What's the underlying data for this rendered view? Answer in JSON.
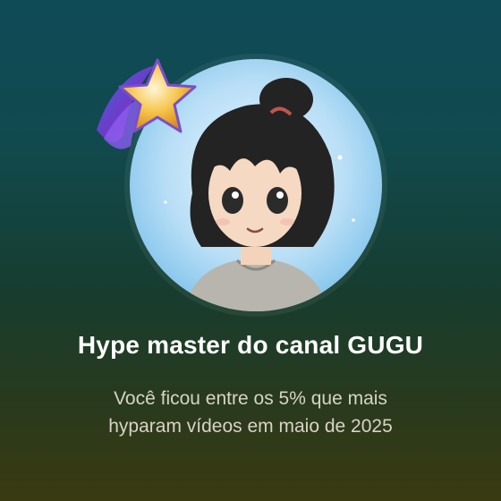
{
  "card": {
    "title": "Hype master do canal GUGU",
    "subtitle_lines": [
      "Você ficou entre os 5% que mais",
      "hyparam vídeos em maio de 2025"
    ]
  },
  "icons": {
    "avatar": "anime-avatar-image",
    "badge": "star-badge-icon"
  },
  "colors": {
    "title": "#ffffff",
    "subtitle": "#d7d3c6",
    "star_gold": "#f6c44a",
    "star_purple": "#6c3cc9"
  }
}
